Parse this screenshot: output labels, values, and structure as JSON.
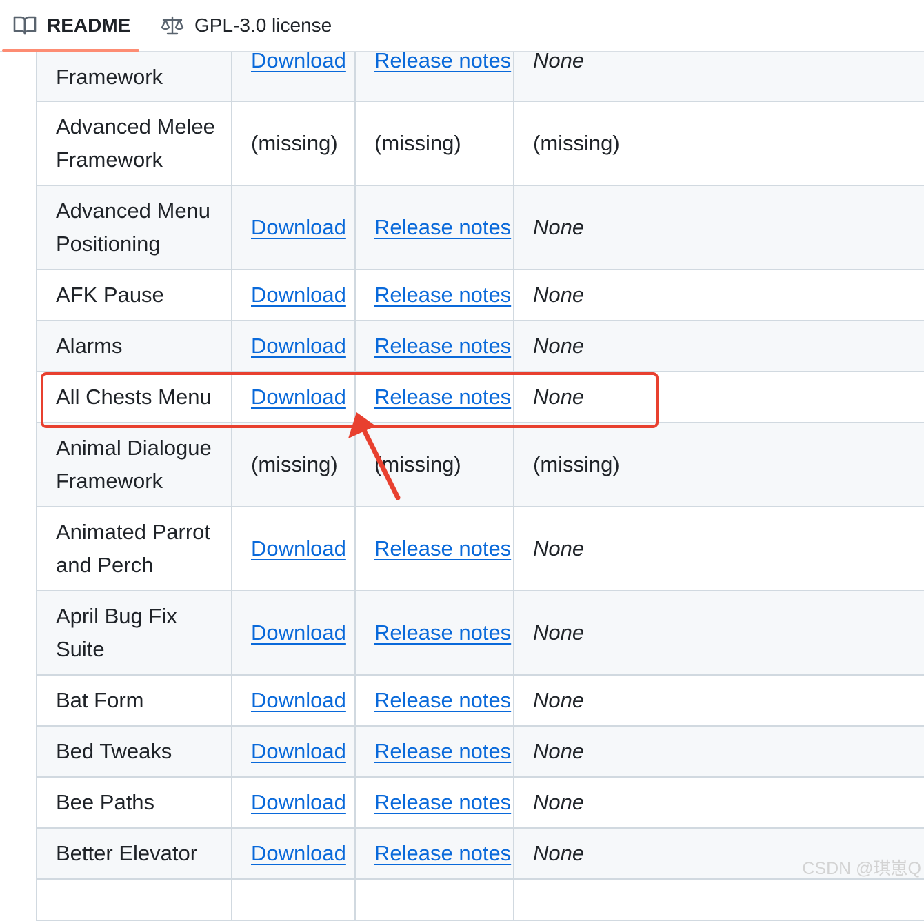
{
  "tabs": {
    "readme_label": "README",
    "license_label": "GPL-3.0 license"
  },
  "table": {
    "rows": [
      {
        "name": "Framework",
        "download": "Download",
        "notes": "Release notes",
        "requirements": "None",
        "available": true
      },
      {
        "name": "Advanced Melee Framework",
        "download": "(missing)",
        "notes": "(missing)",
        "requirements": "(missing)",
        "available": false
      },
      {
        "name": "Advanced Menu Positioning",
        "download": "Download",
        "notes": "Release notes",
        "requirements": "None",
        "available": true
      },
      {
        "name": "AFK Pause",
        "download": "Download",
        "notes": "Release notes",
        "requirements": "None",
        "available": true
      },
      {
        "name": "Alarms",
        "download": "Download",
        "notes": "Release notes",
        "requirements": "None",
        "available": true
      },
      {
        "name": "All Chests Menu",
        "download": "Download",
        "notes": "Release notes",
        "requirements": "None",
        "available": true
      },
      {
        "name": "Animal Dialogue Framework",
        "download": "(missing)",
        "notes": "(missing)",
        "requirements": "(missing)",
        "available": false
      },
      {
        "name": "Animated Parrot and Perch",
        "download": "Download",
        "notes": "Release notes",
        "requirements": "None",
        "available": true
      },
      {
        "name": "April Bug Fix Suite",
        "download": "Download",
        "notes": "Release notes",
        "requirements": "None",
        "available": true
      },
      {
        "name": "Bat Form",
        "download": "Download",
        "notes": "Release notes",
        "requirements": "None",
        "available": true
      },
      {
        "name": "Bed Tweaks",
        "download": "Download",
        "notes": "Release notes",
        "requirements": "None",
        "available": true
      },
      {
        "name": "Bee Paths",
        "download": "Download",
        "notes": "Release notes",
        "requirements": "None",
        "available": true
      },
      {
        "name": "Better Elevator",
        "download": "Download",
        "notes": "Release notes",
        "requirements": "None",
        "available": true
      },
      {
        "name": "",
        "download": "",
        "notes": "",
        "requirements": "",
        "available": false
      }
    ]
  },
  "annotation": {
    "highlighted_row": "All Chests Menu",
    "color": "#e8402f"
  },
  "watermark": "CSDN @琪崽Q",
  "colors": {
    "link": "#0969da",
    "tab_underline": "#fd8c73",
    "row_stripe": "#f6f8fa",
    "border": "#d1d9e0"
  }
}
